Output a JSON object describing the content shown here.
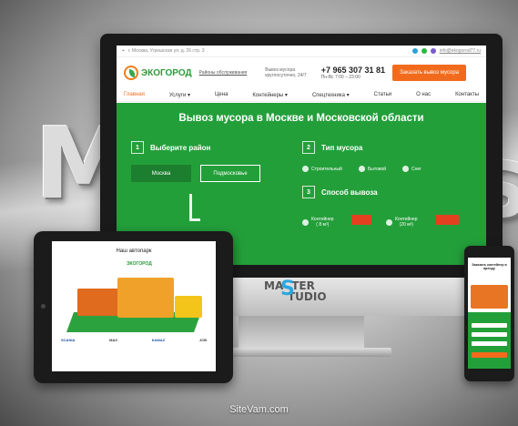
{
  "background": {
    "text_left": "M",
    "text_right": "S"
  },
  "site": {
    "topbar": {
      "address": "г. Москва, Угрешская ул. д. 26 стр. 3",
      "email": "info@ekogorod77.ru"
    },
    "logo": "ЭКОГОРОД",
    "region_link": "Районы обслуживания",
    "service_note": [
      "Вывоз мусора",
      "круглосуточно, 24/7"
    ],
    "phone": "+7 965 307 31 81",
    "hours": "Пн-Вс 7:00 – 23:00",
    "order_button": "Заказать вывоз мусора",
    "nav": [
      "Главная",
      "Услуги",
      "Цена",
      "Контейнеры",
      "Спецтехника",
      "Статьи",
      "О нас",
      "Контакты"
    ],
    "hero_title": "Вывоз мусора в Москве и Московской области",
    "steps": [
      {
        "num": "1",
        "label": "Выберите район"
      },
      {
        "num": "2",
        "label": "Тип мусора"
      },
      {
        "num": "3",
        "label": "Способ вывоза"
      }
    ],
    "district_buttons": [
      "Москва",
      "Подмосковье"
    ],
    "garbage_types": [
      "Строительный",
      "Бытовой",
      "Снег"
    ],
    "removal": [
      {
        "label": "Контейнер",
        "size": "( 8 м³)"
      },
      {
        "label": "Контейнер",
        "size": "(20 м³)"
      }
    ]
  },
  "brand": {
    "line1": "MA",
    "s": "S",
    "line1b": "TER",
    "line2": "TUDIO"
  },
  "tablet": {
    "title": "Наш автопарк",
    "logo": "ЭКОГОРОД",
    "brands": [
      "SCANIA",
      "МАЗ",
      "KAMAZ",
      "JCB"
    ]
  },
  "phone": {
    "title": "Заказать контейнер в аренду"
  },
  "watermark": "SiteVam.com",
  "colors": {
    "green": "#239f3a",
    "orange": "#f26b1d"
  }
}
